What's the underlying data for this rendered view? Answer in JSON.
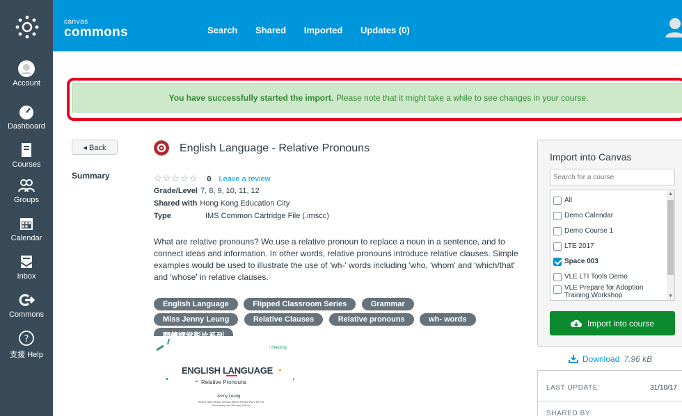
{
  "app": {
    "brand_small": "canvas",
    "brand_big": "commons",
    "accent_color": "#0096db",
    "nav_bg_color": "#394b58"
  },
  "global_nav": {
    "items": [
      {
        "label": "Account",
        "icon": "account-icon"
      },
      {
        "label": "Dashboard",
        "icon": "dashboard-icon"
      },
      {
        "label": "Courses",
        "icon": "courses-icon"
      },
      {
        "label": "Groups",
        "icon": "groups-icon"
      },
      {
        "label": "Calendar",
        "icon": "calendar-icon"
      },
      {
        "label": "Inbox",
        "icon": "inbox-icon"
      },
      {
        "label": "Commons",
        "icon": "commons-icon"
      },
      {
        "label": "支援 Help",
        "icon": "help-icon"
      }
    ]
  },
  "top_nav": {
    "search": "Search",
    "shared": "Shared",
    "imported": "Imported",
    "updates": "Updates (0)"
  },
  "alert": {
    "strong": "You have successfully started the import.",
    "rest": "Please note that it might take a while to see changes in your course.",
    "color": "#2f8a36"
  },
  "back_label": "◂ Back",
  "summary_label": "Summary",
  "resource": {
    "title": "English Language - Relative Pronouns",
    "stars": "☆☆☆☆☆",
    "rating_count": "0",
    "review_link": "Leave a review",
    "grade_label": "Grade/Level",
    "grade_value": "7, 8, 9, 10, 11, 12",
    "shared_label": "Shared with",
    "shared_value": "Hong Kong Education City",
    "type_label": "Type",
    "type_value": "IMS Common Cartridge File (.imscc)",
    "description": "What are relative pronouns? We use a relative pronoun to replace a noun in a sentence, and to connect ideas and information. In other words, relative pronouns introduce relative clauses. Simple examples would be used to illustrate the use of 'wh-' words including 'who, 'whom' and 'which/that' and 'whose' in relative clauses.",
    "tags": [
      "English Language",
      "Flipped Classroom Series",
      "Grammar",
      "Miss Jenny Leung",
      "Relative Clauses",
      "Relative pronouns",
      "wh- words",
      "翻轉課堂影片系列"
    ],
    "thumbnail": {
      "title": "ENGLISH LANGUAGE",
      "subtitle": "Relative Pronouns",
      "author": "Jenny Leung",
      "caption": "Heavy Team Basic Lesson Aimed Series Work Kit For Secondary and Primary School"
    }
  },
  "import_panel": {
    "title": "Import into Canvas",
    "search_placeholder": "Search for a course",
    "courses": [
      {
        "label": "All",
        "checked": false
      },
      {
        "label": "Demo Calendar",
        "checked": false
      },
      {
        "label": "Demo Course 1",
        "checked": false
      },
      {
        "label": "LTE 2017",
        "checked": false
      },
      {
        "label": "Space 003",
        "checked": true
      },
      {
        "label": "VLE LTI Tools Demo",
        "checked": false
      },
      {
        "label": "VLE Prepare for Adoption Training Workshop",
        "checked": false
      }
    ],
    "button_label": "Import into course",
    "button_color": "#0b8a2e"
  },
  "download": {
    "label": "Download",
    "size": "7.96 kB"
  },
  "info": {
    "last_update_label": "LAST UPDATE:",
    "last_update_value": "31/10/17",
    "shared_by_label": "SHARED BY:"
  }
}
